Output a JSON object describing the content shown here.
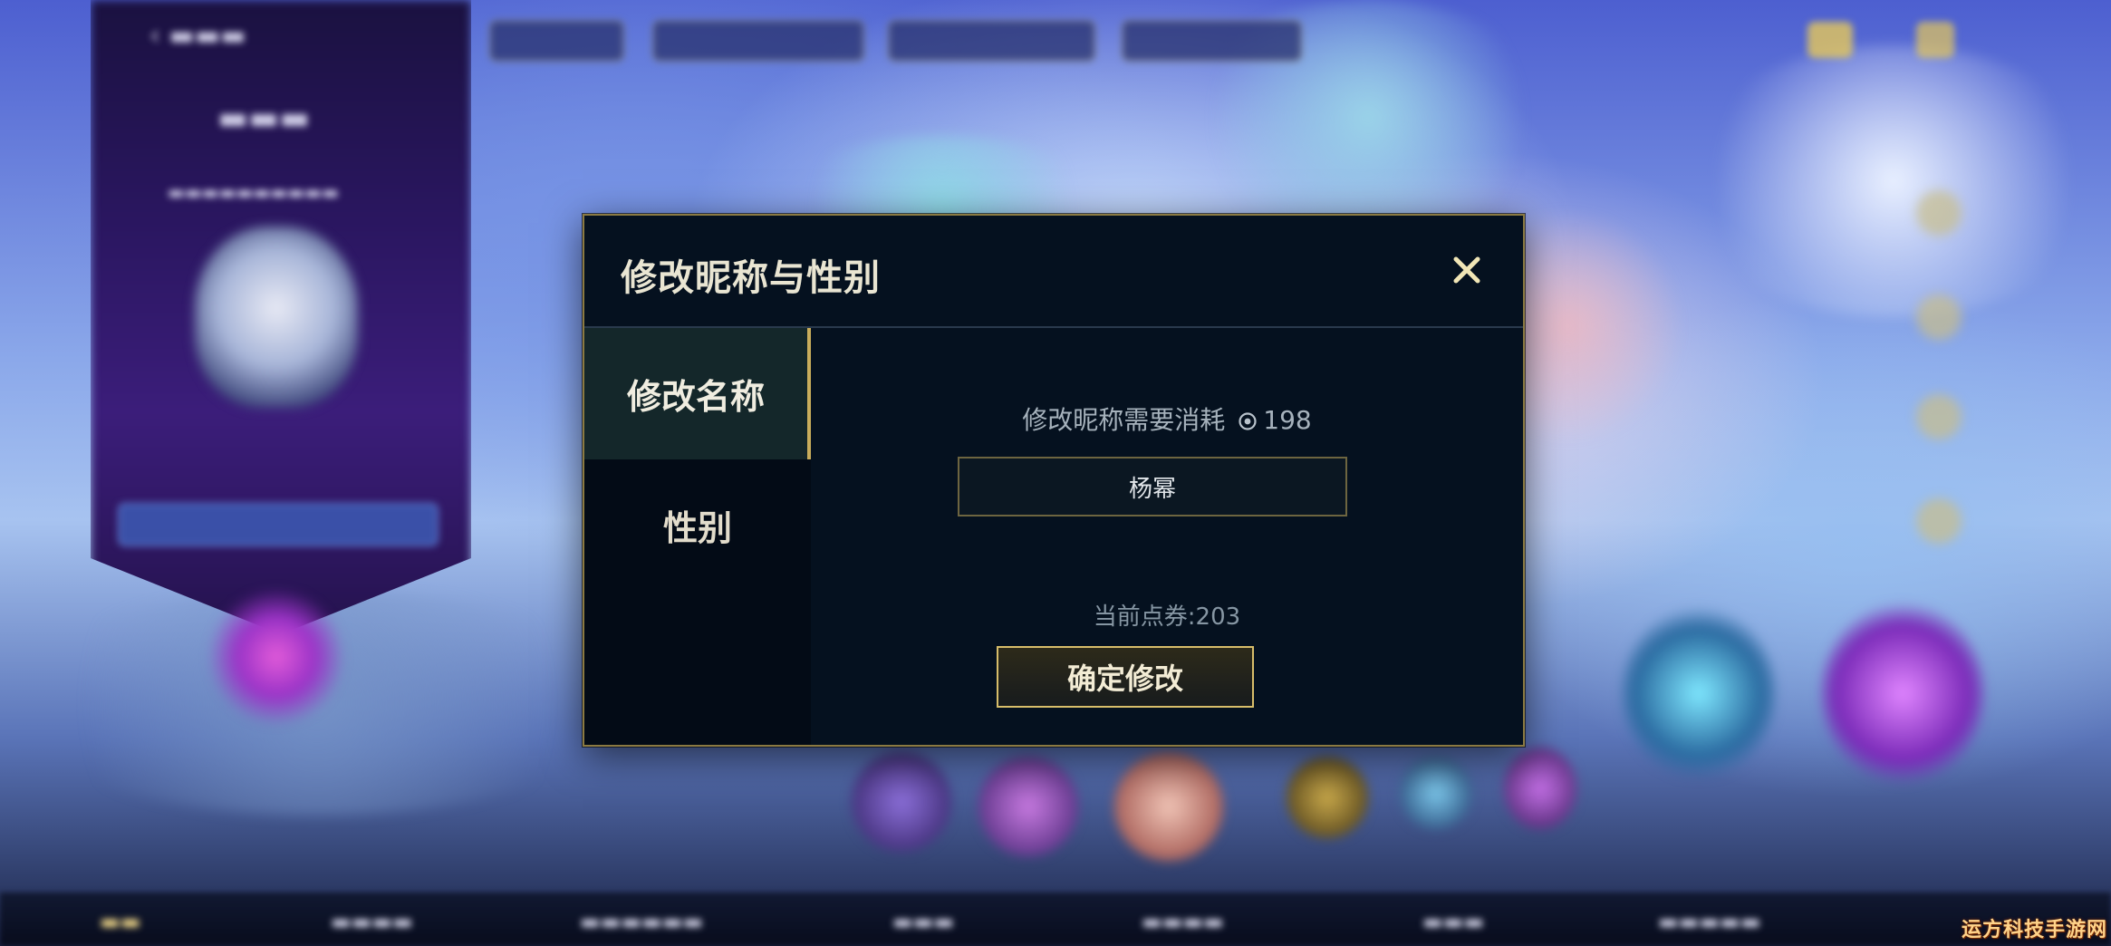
{
  "dialog": {
    "title": "修改昵称与性别",
    "close_icon": "close-icon",
    "tabs": [
      {
        "label": "修改名称",
        "active": true
      },
      {
        "label": "性别",
        "active": false
      }
    ],
    "rename": {
      "cost_text": "修改昵称需要消耗",
      "cost_icon": "coin-icon",
      "cost_amount": "198",
      "name_value": "杨幂",
      "balance_text": "当前点券:203",
      "confirm_label": "确定修改"
    }
  },
  "watermark": "运方科技手游网",
  "colors": {
    "dialog_bg": "#05111f",
    "gold_border": "#d7bd6a",
    "active_tab_bg": "#14272a"
  }
}
